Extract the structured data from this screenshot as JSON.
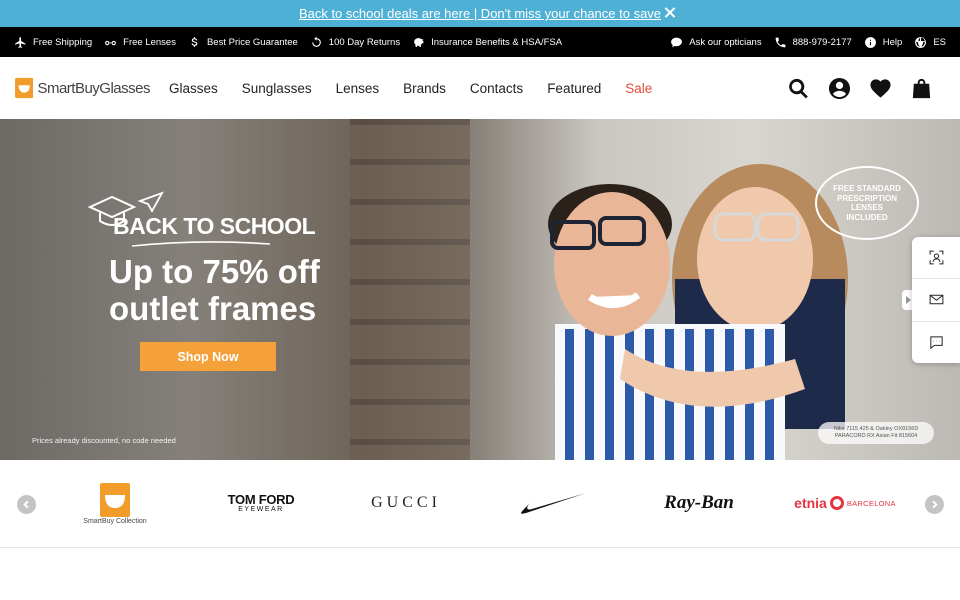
{
  "promo": {
    "text": "Back to school deals are here | Don't miss your chance to save"
  },
  "utility_bar": {
    "left": [
      {
        "label": "Free Shipping",
        "icon": "plane-icon"
      },
      {
        "label": "Free Lenses",
        "icon": "glasses-icon"
      },
      {
        "label": "Best Price Guarantee",
        "icon": "dollar-icon"
      },
      {
        "label": "100 Day Returns",
        "icon": "returns-icon"
      },
      {
        "label": "Insurance Benefits & HSA/FSA",
        "icon": "piggy-bank-icon"
      }
    ],
    "right": [
      {
        "label": "Ask our opticians",
        "icon": "chat-icon"
      },
      {
        "label": "888-979-2177",
        "icon": "phone-icon"
      },
      {
        "label": "Help",
        "icon": "info-icon"
      },
      {
        "label": "ES",
        "icon": "globe-icon"
      }
    ]
  },
  "header": {
    "logo": "SmartBuyGlasses",
    "nav": [
      "Glasses",
      "Sunglasses",
      "Lenses",
      "Brands",
      "Contacts",
      "Featured",
      "Sale"
    ]
  },
  "hero": {
    "title_small": "BACK TO SCHOOL",
    "title_line1": "Up to 75% off",
    "title_line2": "outlet frames",
    "cta": "Shop Now",
    "disclaimer": "Prices already discounted, no code needed",
    "badge_line1": "FREE STANDARD",
    "badge_line2": "PRESCRIPTION",
    "badge_line3": "LENSES",
    "badge_line4": "INCLUDED",
    "legal_line1": "Nike 7115 425 & Oakley OX8156D",
    "legal_line2": "PARACORD RX Asian Fit 815604"
  },
  "brands": {
    "items": [
      {
        "name": "SmartBuy Collection"
      },
      {
        "name_line1": "TOM FORD",
        "name_line2": "EYEWEAR"
      },
      {
        "name": "GUCCI"
      },
      {
        "name": "Nike"
      },
      {
        "name": "Ray-Ban"
      },
      {
        "name_main": "etnia",
        "name_sub": "BARCELONA"
      }
    ]
  },
  "colors": {
    "promo_bg": "#4fb0d6",
    "utility_bg": "#000000",
    "cta": "#f4a13a",
    "sale": "#e44b3a",
    "etnia": "#e3343f"
  }
}
